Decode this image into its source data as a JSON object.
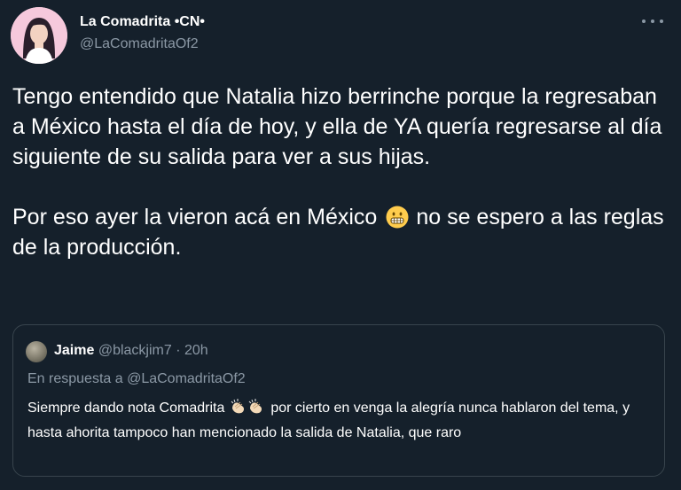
{
  "author": {
    "display_name": "La Comadrita •CN•",
    "handle": "@LaComadritaOf2"
  },
  "tweet": {
    "paragraph1": "Tengo entendido que Natalia hizo berrinche porque la regresaban a México hasta el día de hoy, y ella de YA quería regresarse al día siguiente de su salida para ver a sus hijas.",
    "paragraph2_before": "Por eso ayer la vieron acá en México",
    "paragraph2_after": "no se espero a las reglas de la producción."
  },
  "quote": {
    "name": "Jaime",
    "meta": "@blackjim7 · 20h",
    "reply_line": "En respuesta a @LaComadritaOf2",
    "text_before": "Siempre dando nota Comadrita",
    "text_after": "por cierto en venga la alegría nunca hablaron del tema, y hasta ahorita tampoco han mencionado la salida de Natalia, que raro"
  },
  "icons": {
    "more": "more-icon",
    "emoji": "grimacing-face-icon",
    "clap": "clapping-hands-icon"
  },
  "colors": {
    "background": "#15202b",
    "secondary_text": "#8b98a5",
    "border": "#38444d"
  }
}
